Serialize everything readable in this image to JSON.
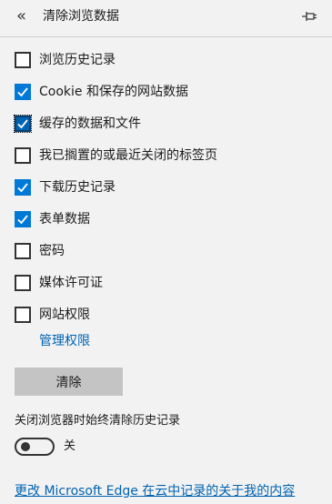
{
  "header": {
    "back_glyph": "«",
    "title": "清除浏览数据",
    "pin_icon": "pin-icon"
  },
  "options": [
    {
      "label": "浏览历史记录",
      "checked": false
    },
    {
      "label": "Cookie 和保存的网站数据",
      "checked": true
    },
    {
      "label": "缓存的数据和文件",
      "checked": true,
      "focused": true
    },
    {
      "label": "我已搁置的或最近关闭的标签页",
      "checked": false
    },
    {
      "label": "下载历史记录",
      "checked": true
    },
    {
      "label": "表单数据",
      "checked": true
    },
    {
      "label": "密码",
      "checked": false
    },
    {
      "label": "媒体许可证",
      "checked": false
    },
    {
      "label": "网站权限",
      "checked": false
    }
  ],
  "manage_permissions_link": "管理权限",
  "clear_button": "清除",
  "always_clear": {
    "label": "关闭浏览器时始终清除历史记录",
    "toggle_on": false,
    "state_text": "关"
  },
  "footer_link": "更改 Microsoft Edge 在云中记录的关于我的内容",
  "colors": {
    "accent": "#0078d7",
    "link": "#0063b1",
    "button_bg": "#c4c4c4",
    "panel_bg": "#f2f2f2"
  }
}
